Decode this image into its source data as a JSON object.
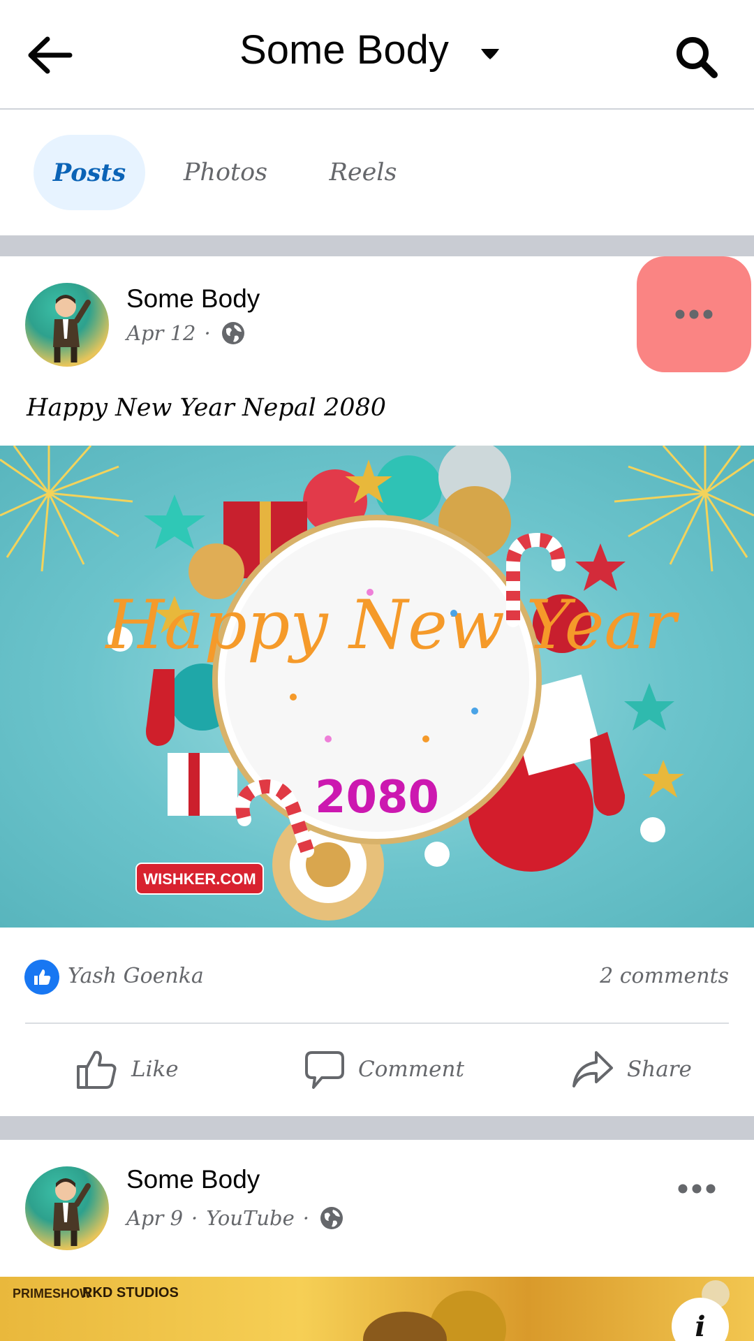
{
  "header": {
    "title": "Some Body",
    "icons": {
      "back": "arrow-left-icon",
      "caret": "caret-down-icon",
      "search": "search-icon"
    }
  },
  "tabs": [
    {
      "label": "Posts",
      "active": true
    },
    {
      "label": "Photos",
      "active": false
    },
    {
      "label": "Reels",
      "active": false
    }
  ],
  "posts": [
    {
      "author": "Some Body",
      "date": "Apr 12",
      "separator": "·",
      "privacy_icon": "globe-icon",
      "text": "Happy New Year Nepal 2080",
      "image": {
        "headline": "Happy New Year",
        "year": "2080",
        "watermark": "WISHKER.COM"
      },
      "reaction_by": "Yash Goenka",
      "comments": "2 comments",
      "actions": {
        "like": "Like",
        "comment": "Comment",
        "share": "Share"
      }
    },
    {
      "author": "Some Body",
      "date": "Apr 9",
      "separator": "·",
      "source": "YouTube",
      "privacy_icon": "globe-icon",
      "image": {
        "logo_left": "PRIMESHOW",
        "logo_right": "RKD STUDIOS"
      },
      "info_label": "i"
    }
  ],
  "colors": {
    "accent_blue": "#1877f2",
    "active_tab_bg": "#e7f3ff",
    "active_tab_text": "#0b63b6",
    "highlight": "#fa8483",
    "divider": "#c9ccd3"
  }
}
